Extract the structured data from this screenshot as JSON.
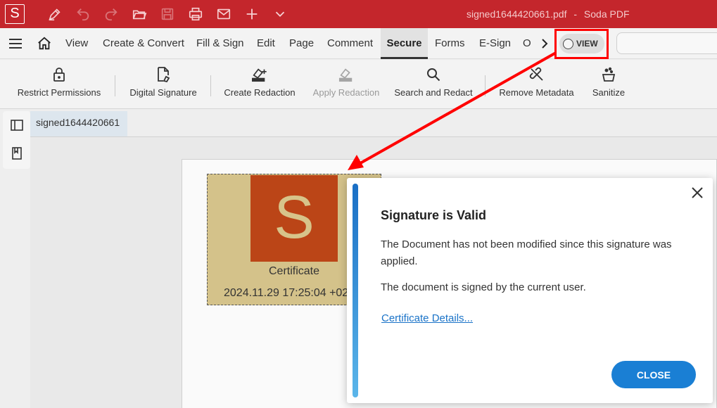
{
  "window": {
    "title": "signed1644420661.pdf",
    "separator": "-",
    "app_name": "Soda PDF",
    "logo_letter": "S"
  },
  "quick_access": [
    "sign-pen-icon",
    "undo-icon",
    "redo-icon",
    "open-folder-icon",
    "save-icon",
    "print-icon",
    "email-icon",
    "add-icon",
    "chevron-down-icon"
  ],
  "menu": {
    "tabs": [
      {
        "label": "View"
      },
      {
        "label": "Create & Convert"
      },
      {
        "label": "Fill & Sign"
      },
      {
        "label": "Edit"
      },
      {
        "label": "Page"
      },
      {
        "label": "Comment"
      },
      {
        "label": "Secure",
        "active": true
      },
      {
        "label": "Forms"
      },
      {
        "label": "E-Sign"
      },
      {
        "label": "O"
      }
    ],
    "view_toggle_label": "VIEW"
  },
  "ribbon": {
    "buttons": [
      {
        "label": "Restrict Permissions",
        "icon": "lock-icon"
      },
      {
        "label": "Digital Signature",
        "icon": "digital-signature-icon"
      },
      {
        "label": "Create Redaction",
        "icon": "create-redaction-icon"
      },
      {
        "label": "Apply Redaction",
        "icon": "apply-redaction-icon",
        "disabled": true
      },
      {
        "label": "Search and Redact",
        "icon": "search-icon"
      },
      {
        "label": "Remove Metadata",
        "icon": "remove-metadata-icon"
      },
      {
        "label": "Sanitize",
        "icon": "sanitize-icon"
      }
    ]
  },
  "document": {
    "tab_label": "signed1644420661",
    "signature": {
      "logo_letter": "S",
      "caption": "Certificate",
      "date": "2024.11.29 17:25:04 +02"
    }
  },
  "dialog": {
    "title": "Signature is Valid",
    "message_1": "The Document has not been modified since this signature was applied.",
    "message_2": "The document is signed by the current user.",
    "link": "Certificate Details...",
    "close_button": "CLOSE"
  },
  "colors": {
    "titlebar": "#c4262c",
    "accent_blue": "#1a7fd4",
    "annotation_red": "#ff0000",
    "signature_bg": "#d4c28a",
    "signature_logo": "#bb4517"
  }
}
